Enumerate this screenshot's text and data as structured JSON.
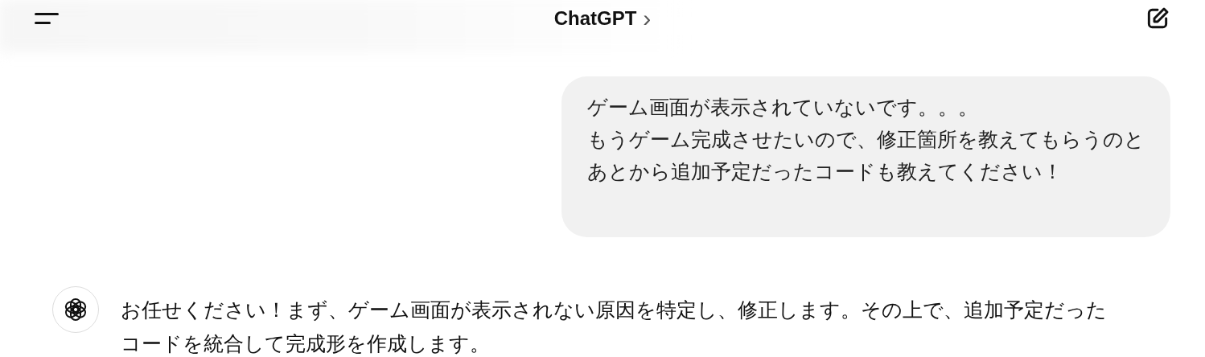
{
  "header": {
    "title": "ChatGPT",
    "chevron": "›"
  },
  "messages": [
    {
      "kind": "user",
      "lines": [
        "ゲーム画面が表示されていないです。。。",
        "もうゲーム完成させたいので、修正箇所を教えてもらうのと",
        "あとから追加予定だったコードも教えてください！"
      ]
    },
    {
      "kind": "assistant",
      "lines": [
        "お任せください！まず、ゲーム画面が表示されない原因を特定し、修正します。その上で、追加予定だった",
        "コードを統合して完成形を作成します。"
      ]
    }
  ]
}
